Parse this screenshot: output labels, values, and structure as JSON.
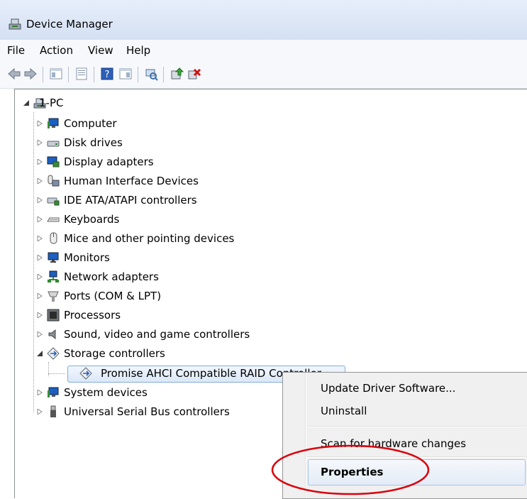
{
  "window": {
    "title": "Device Manager"
  },
  "menu": [
    "File",
    "Action",
    "View",
    "Help"
  ],
  "toolbar": [
    "back-icon",
    "forward-icon",
    "show-hide-tree-icon",
    "properties-icon",
    "help-icon",
    "action-pane-icon",
    "scan-hardware-icon",
    "update-driver-icon",
    "uninstall-icon"
  ],
  "tree": {
    "root": "1-PC",
    "categories": [
      {
        "label": "Computer",
        "icon": "computer-icon"
      },
      {
        "label": "Disk drives",
        "icon": "disk-drive-icon"
      },
      {
        "label": "Display adapters",
        "icon": "display-adapter-icon"
      },
      {
        "label": "Human Interface Devices",
        "icon": "hid-icon"
      },
      {
        "label": "IDE ATA/ATAPI controllers",
        "icon": "ide-controller-icon"
      },
      {
        "label": "Keyboards",
        "icon": "keyboard-icon"
      },
      {
        "label": "Mice and other pointing devices",
        "icon": "mouse-icon"
      },
      {
        "label": "Monitors",
        "icon": "monitor-icon"
      },
      {
        "label": "Network adapters",
        "icon": "network-adapter-icon"
      },
      {
        "label": "Ports (COM & LPT)",
        "icon": "port-icon"
      },
      {
        "label": "Processors",
        "icon": "processor-icon"
      },
      {
        "label": "Sound, video and game controllers",
        "icon": "speaker-icon"
      },
      {
        "label": "Storage controllers",
        "icon": "storage-controller-icon",
        "expanded": true
      },
      {
        "label": "System devices",
        "icon": "system-device-icon"
      },
      {
        "label": "Universal Serial Bus controllers",
        "icon": "usb-icon"
      }
    ],
    "selected_device": "Promise AHCI Compatible RAID Controller"
  },
  "context_menu": {
    "items": [
      "Update Driver Software...",
      "Uninstall",
      "Scan for hardware changes",
      "Properties"
    ],
    "highlighted": "Properties",
    "highlight_color": "#d9000d"
  }
}
